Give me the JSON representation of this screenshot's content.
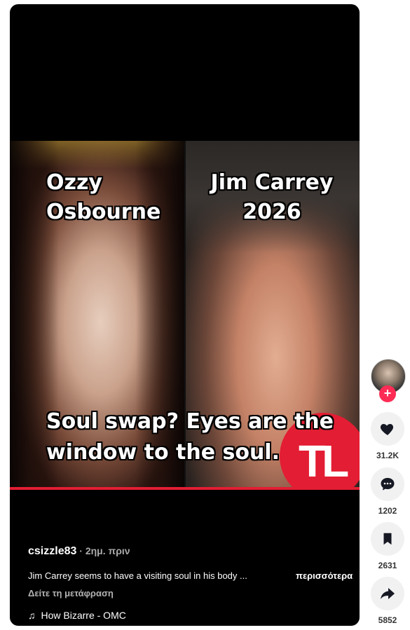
{
  "video": {
    "left_name": [
      "Ozzy",
      "Osbourne"
    ],
    "right_name": [
      "Jim Carrey",
      "2026"
    ],
    "caption": [
      "Soul swap? Eyes are the",
      "window to the soul."
    ],
    "mic_logo": "TL"
  },
  "post": {
    "username": "csizzle83",
    "time": " · 2ημ. πριν",
    "description": "Jim Carrey seems to have a visiting soul in his body ...",
    "more_label": "περισσότερα",
    "translate_label": "Δείτε τη μετάφραση",
    "music_icon": "music-note-icon",
    "music": "How Bizarre - OMC"
  },
  "actions": {
    "follow_label": "+",
    "likes": "31.2K",
    "comments": "1202",
    "saves": "2631",
    "shares": "5852"
  },
  "colors": {
    "accent": "#fe2c55",
    "card_bg": "#000000",
    "button_bg": "#f1f1f2"
  }
}
